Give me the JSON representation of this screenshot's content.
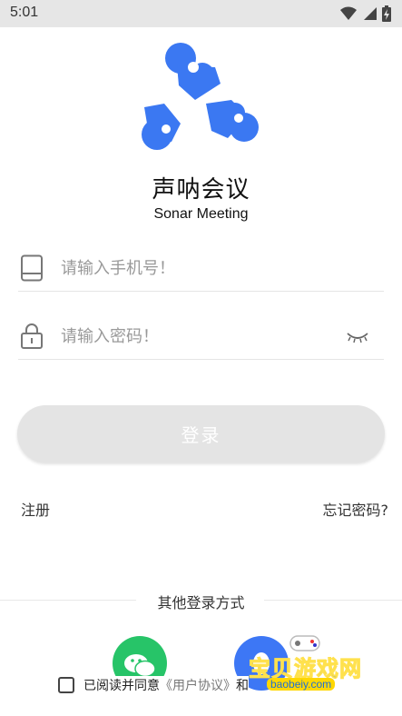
{
  "status_bar": {
    "time": "5:01"
  },
  "app": {
    "title": "声呐会议",
    "subtitle": "Sonar Meeting"
  },
  "phone_field": {
    "placeholder": "请输入手机号！",
    "value": ""
  },
  "password_field": {
    "placeholder": "请输入密码！",
    "value": ""
  },
  "login_button": {
    "label": "登录"
  },
  "links": {
    "register": "注册",
    "forgot_password": "忘记密码?"
  },
  "other_login": {
    "label": "其他登录方式"
  },
  "agreement": {
    "prefix": "已阅读并同意",
    "link": "《用户协议》",
    "suffix": "和"
  },
  "watermark": {
    "text": "宝贝游戏网",
    "url": "baobeiy.com"
  },
  "colors": {
    "logo_blue": "#3b78f2",
    "wechat_green": "#27c468",
    "qq_blue": "#3d77f5",
    "button_disabled": "#e4e4e4"
  },
  "icons": [
    "wifi-icon",
    "signal-icon",
    "battery-icon",
    "phone-icon",
    "lock-icon",
    "eye-closed-icon",
    "wechat-icon",
    "qq-icon"
  ]
}
